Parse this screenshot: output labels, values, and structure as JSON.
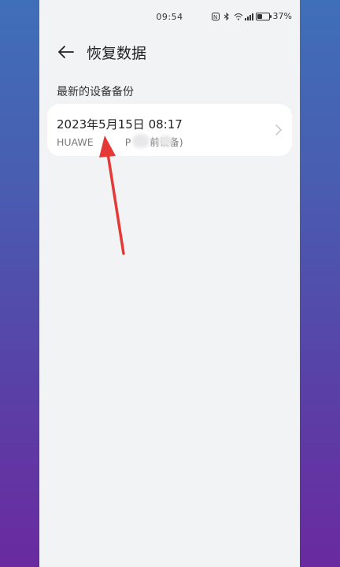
{
  "status_bar": {
    "time": "09:54",
    "battery": "37%"
  },
  "header": {
    "title": "恢复数据"
  },
  "section": {
    "label": "最新的设备备份"
  },
  "backup_item": {
    "date": "2023年5月15日 08:17",
    "device_prefix": "HUAWE",
    "device_mid": "P",
    "device_suffix": "前设备)"
  },
  "colors": {
    "annotation_arrow": "#e53935"
  }
}
